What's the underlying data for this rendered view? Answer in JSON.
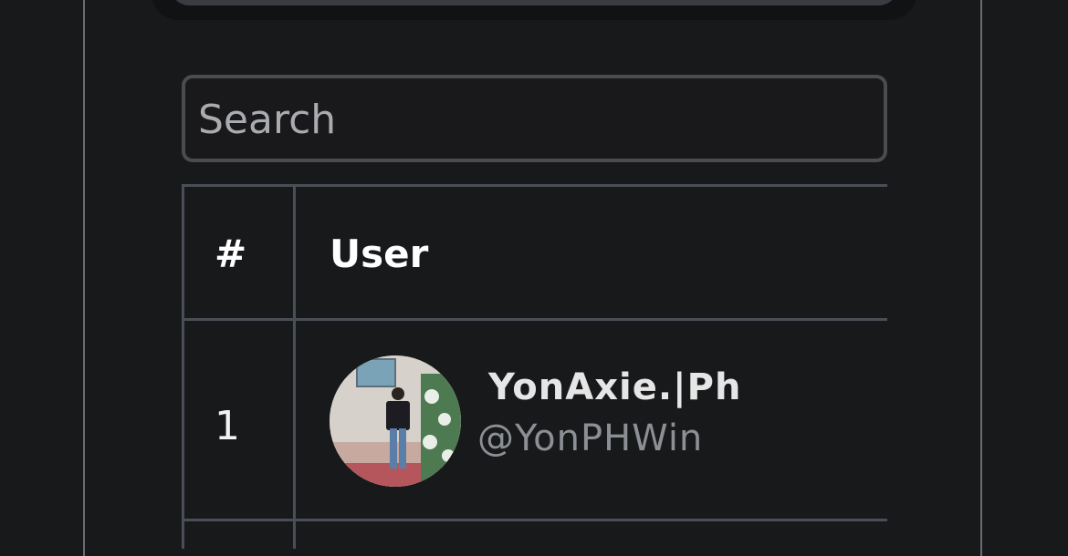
{
  "search": {
    "placeholder": "Search"
  },
  "table": {
    "columns": [
      "#",
      "User"
    ],
    "rows": [
      {
        "rank": "1",
        "display_name": "YonAxie.|Ph",
        "handle": "@YonPHWin"
      }
    ]
  },
  "colors": {
    "background": "#18191b",
    "border": "#4a4f57",
    "text": "#ffffff",
    "muted": "#8c8f94"
  }
}
